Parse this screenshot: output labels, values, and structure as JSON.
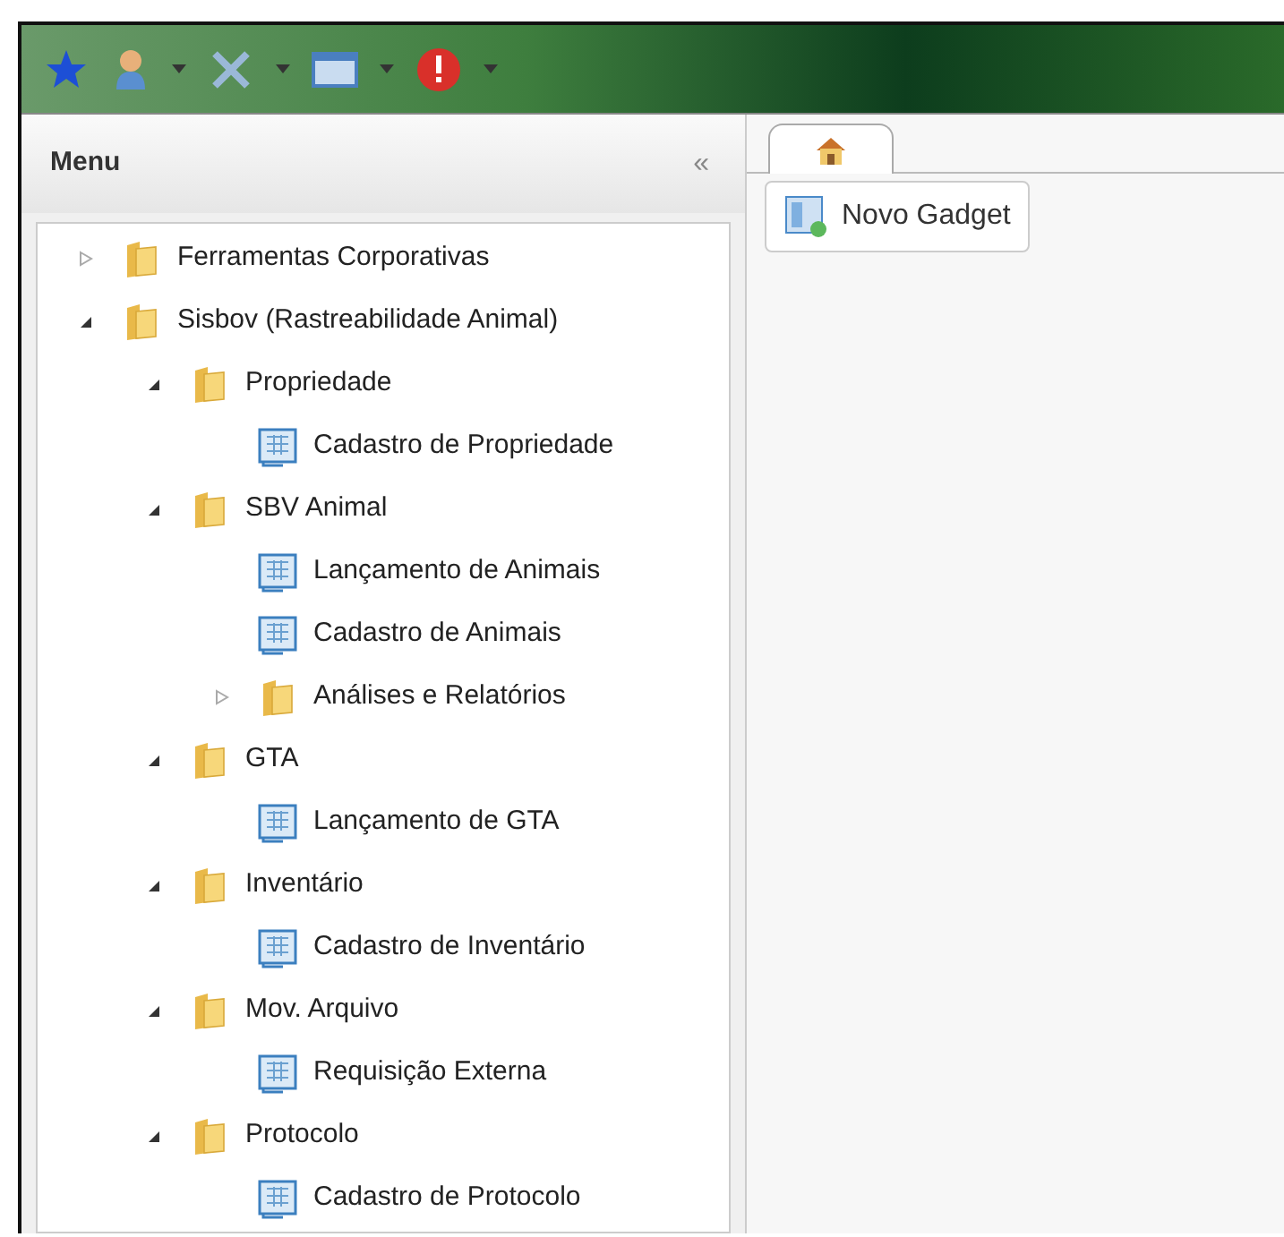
{
  "menu": {
    "title": "Menu",
    "collapse_label": "«"
  },
  "tree": [
    {
      "kind": "folder",
      "label": "Ferramentas Corporativas",
      "expanded": false
    },
    {
      "kind": "folder",
      "label": "Sisbov (Rastreabilidade Animal)",
      "expanded": true,
      "children": [
        {
          "kind": "folder",
          "label": "Propriedade",
          "expanded": true,
          "children": [
            {
              "kind": "form",
              "label": "Cadastro de Propriedade"
            }
          ]
        },
        {
          "kind": "folder",
          "label": "SBV Animal",
          "expanded": true,
          "children": [
            {
              "kind": "form",
              "label": "Lançamento de Animais"
            },
            {
              "kind": "form",
              "label": "Cadastro de Animais"
            },
            {
              "kind": "folder",
              "label": "Análises e Relatórios",
              "expanded": false
            }
          ]
        },
        {
          "kind": "folder",
          "label": "GTA",
          "expanded": true,
          "children": [
            {
              "kind": "form",
              "label": "Lançamento de GTA"
            }
          ]
        },
        {
          "kind": "folder",
          "label": "Inventário",
          "expanded": true,
          "children": [
            {
              "kind": "form",
              "label": "Cadastro de Inventário"
            }
          ]
        },
        {
          "kind": "folder",
          "label": "Mov. Arquivo",
          "expanded": true,
          "children": [
            {
              "kind": "form",
              "label": "Requisição Externa"
            }
          ]
        },
        {
          "kind": "folder",
          "label": "Protocolo",
          "expanded": true,
          "children": [
            {
              "kind": "form",
              "label": "Cadastro de Protocolo"
            }
          ]
        }
      ]
    }
  ],
  "tabs": [
    {
      "kind": "home",
      "selected": true
    }
  ],
  "gadget_button": {
    "label": "Novo Gadget"
  }
}
